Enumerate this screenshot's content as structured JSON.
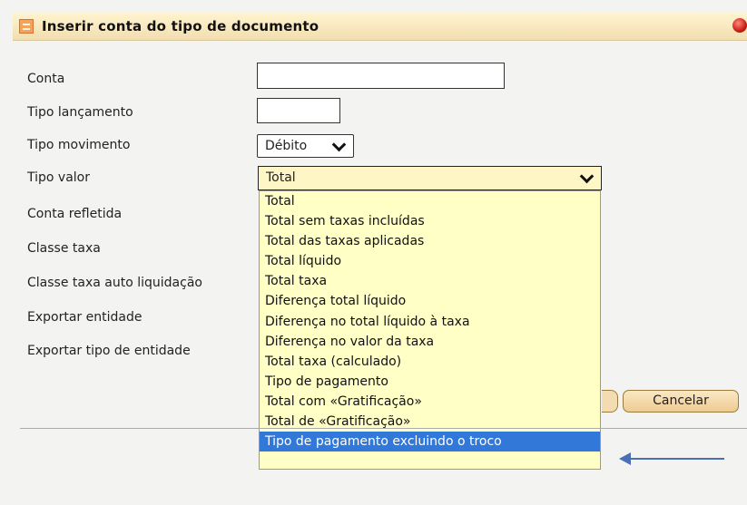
{
  "dialog": {
    "title": "Inserir conta do tipo de documento"
  },
  "form": {
    "labels": [
      "Conta",
      "Tipo lançamento",
      "Tipo movimento",
      "Tipo valor",
      "Conta refletida",
      "Classe taxa",
      "Classe taxa auto liquidação",
      "Exportar entidade",
      "Exportar tipo de entidade"
    ],
    "conta_value": "",
    "tipo_lancamento_value": "",
    "tipo_movimento_value": "Débito",
    "tipo_valor_value": "Total"
  },
  "dropdown": {
    "options": [
      "Total",
      "Total sem taxas incluídas",
      "Total das taxas aplicadas",
      "Total líquido",
      "Total taxa",
      "Diferença total líquido",
      "Diferença no total líquido à taxa",
      "Diferença no valor da taxa",
      "Total taxa (calculado)",
      "Tipo de pagamento",
      "Total com «Gratificação»",
      "Total de «Gratificação»",
      "Tipo de pagamento excluindo o troco"
    ],
    "highlighted_index": 12
  },
  "buttons": {
    "cancel_label": "Cancelar"
  },
  "colors": {
    "title_bar": "#f2deb0",
    "dropdown_bg": "#ffffc6",
    "highlight": "#3178d8",
    "annotation_arrow": "#4a6fb5"
  },
  "icons": [
    "document-icon",
    "close-icon",
    "chevron-down-icon",
    "annotation-arrow-icon"
  ]
}
